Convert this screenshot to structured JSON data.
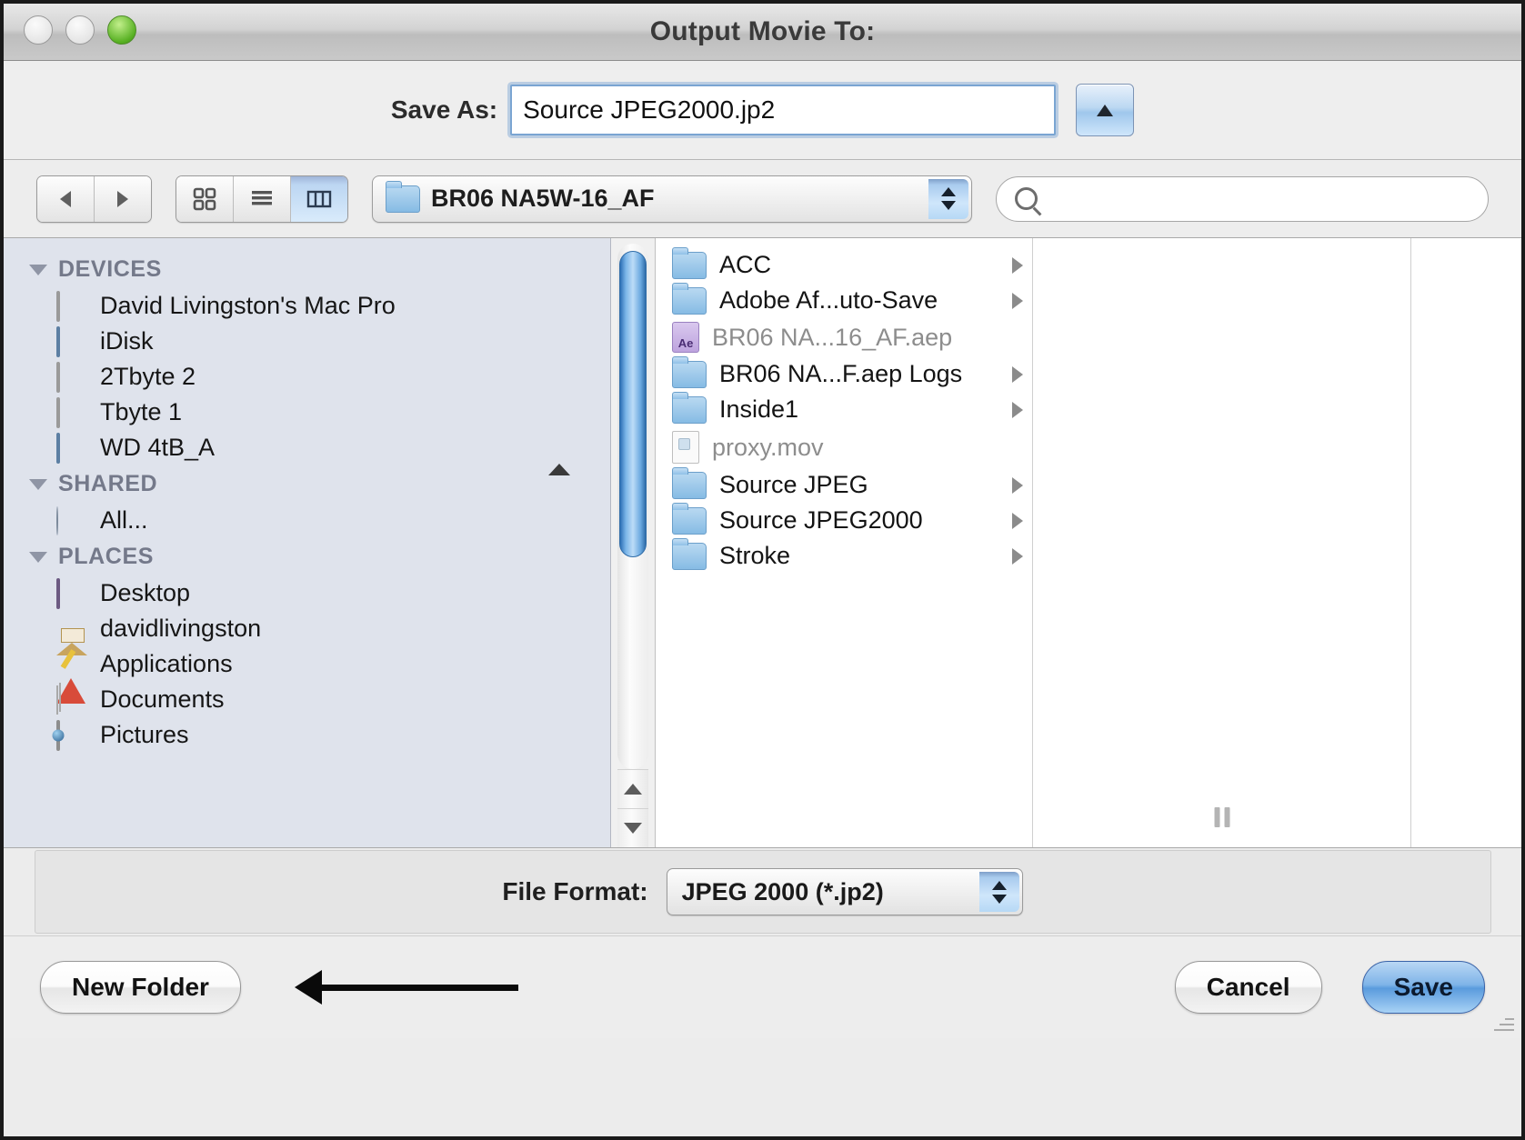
{
  "window": {
    "title": "Output Movie To:",
    "traffic_lights": [
      "close",
      "minimize",
      "zoom"
    ]
  },
  "save_as": {
    "label": "Save As:",
    "value": "Source JPEG2000.jp2",
    "placeholder": "",
    "disclosure_icon": "triangle-up-icon"
  },
  "toolbar": {
    "back_icon": "back-arrow-icon",
    "forward_icon": "forward-arrow-icon",
    "views": [
      {
        "name": "icon-view",
        "icon": "grid-icon",
        "selected": false
      },
      {
        "name": "list-view",
        "icon": "list-icon",
        "selected": false
      },
      {
        "name": "column-view",
        "icon": "columns-icon",
        "selected": true
      }
    ],
    "path_popup": {
      "label": "BR06 NA5W-16_AF",
      "icon": "folder-icon"
    },
    "search": {
      "icon": "search-icon",
      "value": "",
      "placeholder": ""
    }
  },
  "sidebar": {
    "groups": [
      {
        "label": "DEVICES",
        "items": [
          {
            "label": "David  Livingston's Mac Pro",
            "icon": "mac-pro-icon",
            "eject": false
          },
          {
            "label": "iDisk",
            "icon": "idisk-icon",
            "eject": false
          },
          {
            "label": "2Tbyte 2",
            "icon": "hard-drive-icon",
            "eject": false
          },
          {
            "label": "Tbyte 1",
            "icon": "hard-drive-icon",
            "eject": false
          },
          {
            "label": "WD 4tB_A",
            "icon": "external-drive-icon",
            "eject": true
          }
        ]
      },
      {
        "label": "SHARED",
        "items": [
          {
            "label": "All...",
            "icon": "network-globe-icon",
            "eject": false
          }
        ]
      },
      {
        "label": "PLACES",
        "items": [
          {
            "label": "Desktop",
            "icon": "desktop-icon",
            "eject": false
          },
          {
            "label": "davidlivingston",
            "icon": "home-icon",
            "eject": false
          },
          {
            "label": "Applications",
            "icon": "applications-icon",
            "eject": false
          },
          {
            "label": "Documents",
            "icon": "documents-icon",
            "eject": false
          },
          {
            "label": "Pictures",
            "icon": "pictures-icon",
            "eject": false
          }
        ]
      }
    ]
  },
  "file_column": {
    "items": [
      {
        "name": "ACC",
        "icon": "folder-icon",
        "has_children": true,
        "dimmed": false
      },
      {
        "name": "Adobe Af...uto-Save",
        "icon": "folder-icon",
        "has_children": true,
        "dimmed": false
      },
      {
        "name": "BR06 NA...16_AF.aep",
        "icon": "after-effects-file-icon",
        "has_children": false,
        "dimmed": true
      },
      {
        "name": "BR06 NA...F.aep Logs",
        "icon": "folder-icon",
        "has_children": true,
        "dimmed": false
      },
      {
        "name": "Inside1",
        "icon": "folder-icon",
        "has_children": true,
        "dimmed": false
      },
      {
        "name": "proxy.mov",
        "icon": "movie-file-icon",
        "has_children": false,
        "dimmed": true
      },
      {
        "name": "Source JPEG",
        "icon": "folder-icon",
        "has_children": true,
        "dimmed": false
      },
      {
        "name": "Source JPEG2000",
        "icon": "folder-icon",
        "has_children": true,
        "dimmed": false
      },
      {
        "name": "Stroke",
        "icon": "folder-icon",
        "has_children": true,
        "dimmed": false
      }
    ]
  },
  "file_format": {
    "label": "File Format:",
    "value": "JPEG 2000 (*.jp2)"
  },
  "buttons": {
    "new_folder": "New Folder",
    "cancel": "Cancel",
    "save": "Save"
  },
  "annotation": {
    "arrow": "left-pointing-arrow",
    "points_to": "New Folder"
  },
  "colors": {
    "accent_blue": "#5a9bdd",
    "scrollbar_blue": "#2c6fb5",
    "sidebar_bg": "#dfe3ec",
    "window_bg": "#ececec"
  }
}
